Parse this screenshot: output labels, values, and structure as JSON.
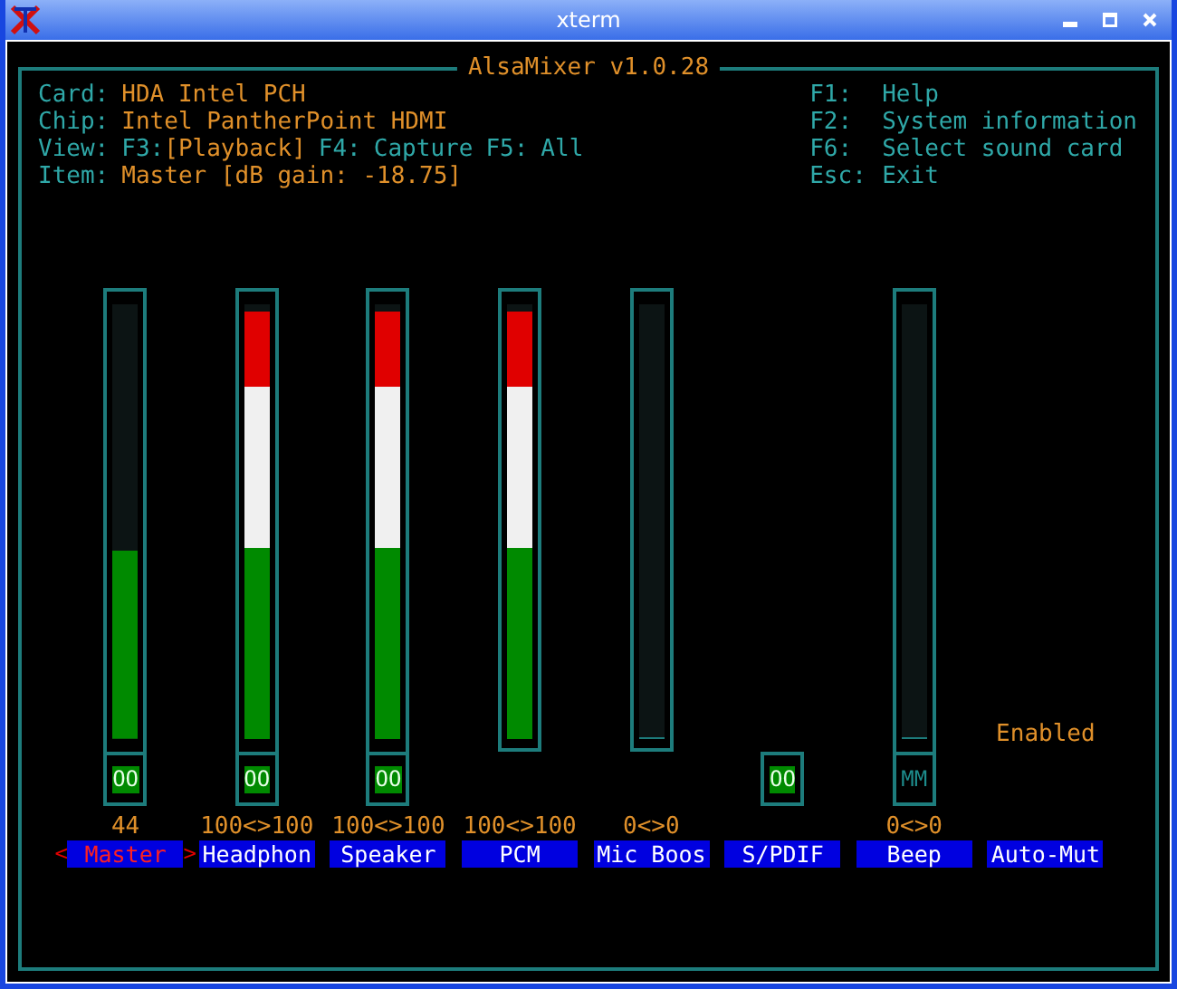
{
  "window": {
    "title": "xterm"
  },
  "mixer": {
    "title": "AlsaMixer v1.0.28",
    "info": [
      {
        "label": "Card:",
        "value": "HDA Intel PCH"
      },
      {
        "label": "Chip:",
        "value": "Intel PantherPoint HDMI"
      }
    ],
    "view": {
      "label": "View:",
      "modes": [
        {
          "key": "F3:",
          "name": "[Playback]",
          "selected": true
        },
        {
          "key": "F4:",
          "name": "Capture",
          "selected": false
        },
        {
          "key": "F5:",
          "name": "All",
          "selected": false
        }
      ]
    },
    "item": {
      "label": "Item:",
      "value": "Master [dB gain: -18.75]"
    },
    "keys": [
      {
        "key": "F1:",
        "action": "Help"
      },
      {
        "key": "F2:",
        "action": "System information"
      },
      {
        "key": "F6:",
        "action": "Select sound card"
      },
      {
        "key": "Esc:",
        "action": "Exit"
      }
    ],
    "selection_marks": {
      "left": "<",
      "right": ">"
    },
    "channels": [
      {
        "kind": "volume",
        "name": "Master",
        "selected": true,
        "level": 0.44,
        "switch": "OO",
        "muted": false,
        "value": "44"
      },
      {
        "kind": "volume",
        "name": "Headphon",
        "selected": false,
        "level": 1,
        "switch": "OO",
        "muted": false,
        "value": "100<>100"
      },
      {
        "kind": "volume",
        "name": "Speaker",
        "selected": false,
        "level": 1,
        "switch": "OO",
        "muted": false,
        "value": "100<>100"
      },
      {
        "kind": "volume",
        "name": "PCM",
        "selected": false,
        "level": 1,
        "value": "100<>100"
      },
      {
        "kind": "volume",
        "name": "Mic Boos",
        "selected": false,
        "level": 0,
        "value": "0<>0"
      },
      {
        "kind": "switch",
        "name": "S/PDIF",
        "selected": false,
        "switch": "OO",
        "muted": false
      },
      {
        "kind": "volume",
        "name": "Beep",
        "selected": false,
        "level": 0,
        "switch": "MM",
        "muted": true,
        "value": "0<>0"
      },
      {
        "kind": "enum",
        "name": "Auto-Mut",
        "selected": false,
        "option": "Enabled"
      }
    ]
  }
}
